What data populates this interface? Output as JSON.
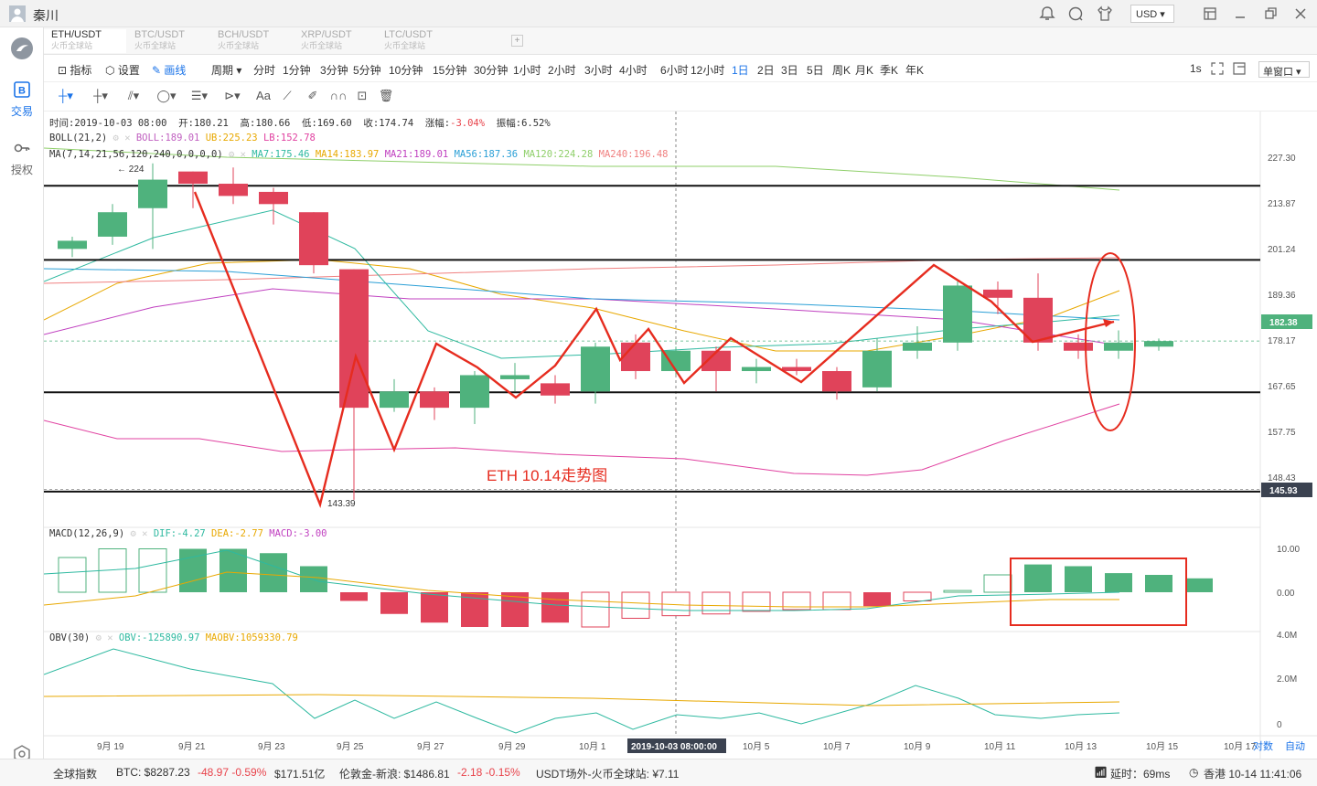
{
  "window": {
    "user_name": "秦川",
    "currency": "USD ▾"
  },
  "sidebar": {
    "trade_label": "交易",
    "auth_label": "授权"
  },
  "tabs": [
    {
      "pair": "ETH/USDT",
      "sub": "火币全球站"
    },
    {
      "pair": "BTC/USDT",
      "sub": "火币全球站"
    },
    {
      "pair": "BCH/USDT",
      "sub": "火币全球站"
    },
    {
      "pair": "XRP/USDT",
      "sub": "火币全球站"
    },
    {
      "pair": "LTC/USDT",
      "sub": "火币全球站"
    }
  ],
  "toolbar": {
    "indicator": "指标",
    "settings": "设置",
    "draw": "画线",
    "period": "周期",
    "periods": [
      "分时",
      "1分钟",
      "3分钟",
      "5分钟",
      "10分钟",
      "15分钟",
      "30分钟",
      "1小时",
      "2小时",
      "3小时",
      "4小时",
      "6小时",
      "12小时",
      "1日",
      "2日",
      "3日",
      "5日",
      "周K",
      "月K",
      "季K",
      "年K"
    ],
    "active_period": "1日",
    "speed": "1s",
    "window_mode": "单窗口 ▾"
  },
  "info_lines": {
    "time": "时间:2019-10-03 08:00",
    "open_label": "开:",
    "open": "180.21",
    "high_label": "高:",
    "high": "180.66",
    "low_label": "低:",
    "low": "169.60",
    "close_label": "收:",
    "close": "174.74",
    "change_label": "涨幅:",
    "change": "-3.04%",
    "amp_label": "振幅:",
    "amp": "6.52%",
    "boll_name": "BOLL(21,2)",
    "boll": "BOLL:189.01",
    "ub": "UB:225.23",
    "lb": "LB:152.78",
    "ma_name": "MA(7,14,21,56,120,240,0,0,0,0)",
    "ma7": "MA7:175.46",
    "ma14": "MA14:183.97",
    "ma21": "MA21:189.01",
    "ma56": "MA56:187.36",
    "ma120": "MA120:224.28",
    "ma240": "MA240:196.48",
    "macd_name": "MACD(12,26,9)",
    "dif": "DIF:-4.27",
    "dea": "DEA:-2.77",
    "macd": "MACD:-3.00",
    "obv_name": "OBV(30)",
    "obv": "OBV:-125890.97",
    "maobv": "MAOBV:1059330.79"
  },
  "chart_data": {
    "type": "candlestick",
    "title": "ETH 10.14走势图",
    "x_labels": [
      "9月 19",
      "9月 21",
      "9月 23",
      "9月 25",
      "9月 27",
      "9月 29",
      "10月 1",
      "2019-10-03 08:00:00",
      "10月 5",
      "10月 7",
      "10月 9",
      "10月 11",
      "10月 13",
      "10月 15",
      "10月 17"
    ],
    "y_ticks": [
      "227.30",
      "213.87",
      "201.24",
      "189.36",
      "178.17",
      "167.65",
      "157.75",
      "148.43"
    ],
    "current_price": "182.38",
    "low_marker": "145.93",
    "high_annotation": "← 224",
    "low_annotation": "143.39",
    "macd_ticks": [
      "10.00",
      "0.00"
    ],
    "obv_ticks": [
      "4.0M",
      "2.0M",
      "0"
    ],
    "log_label": "对数",
    "auto_label": "自动",
    "candles": [
      {
        "o": 205,
        "h": 208,
        "l": 203,
        "c": 207
      },
      {
        "o": 208,
        "h": 216,
        "l": 206,
        "c": 214
      },
      {
        "o": 215,
        "h": 226,
        "l": 205,
        "c": 222
      },
      {
        "o": 224,
        "h": 224,
        "l": 215,
        "c": 221
      },
      {
        "o": 221,
        "h": 225,
        "l": 216,
        "c": 218
      },
      {
        "o": 219,
        "h": 220,
        "l": 211,
        "c": 216
      },
      {
        "o": 214,
        "h": 214,
        "l": 199,
        "c": 201
      },
      {
        "o": 200,
        "h": 200,
        "l": 143.39,
        "c": 166
      },
      {
        "o": 166,
        "h": 173,
        "l": 165,
        "c": 170
      },
      {
        "o": 170,
        "h": 171,
        "l": 163,
        "c": 166
      },
      {
        "o": 166,
        "h": 175,
        "l": 162,
        "c": 174
      },
      {
        "o": 173,
        "h": 177,
        "l": 170,
        "c": 174
      },
      {
        "o": 172,
        "h": 174,
        "l": 167,
        "c": 169
      },
      {
        "o": 170,
        "h": 182,
        "l": 167,
        "c": 181
      },
      {
        "o": 182,
        "h": 184,
        "l": 173,
        "c": 175
      },
      {
        "o": 175,
        "h": 181,
        "l": 174,
        "c": 180
      },
      {
        "o": 180,
        "h": 181,
        "l": 170,
        "c": 175
      },
      {
        "o": 175,
        "h": 178,
        "l": 172,
        "c": 176
      },
      {
        "o": 176,
        "h": 178,
        "l": 174,
        "c": 175
      },
      {
        "o": 175,
        "h": 176,
        "l": 168,
        "c": 170
      },
      {
        "o": 171,
        "h": 183,
        "l": 170,
        "c": 180
      },
      {
        "o": 180,
        "h": 186,
        "l": 178,
        "c": 182
      },
      {
        "o": 182,
        "h": 197,
        "l": 180,
        "c": 196
      },
      {
        "o": 195,
        "h": 197,
        "l": 189,
        "c": 193
      },
      {
        "o": 193,
        "h": 199,
        "l": 180,
        "c": 182
      },
      {
        "o": 182,
        "h": 184,
        "l": 178,
        "c": 180
      },
      {
        "o": 180,
        "h": 185,
        "l": 178,
        "c": 182
      },
      {
        "o": 181,
        "h": 183,
        "l": 180,
        "c": 182.38
      }
    ],
    "macd_bars": [
      4,
      5,
      5,
      5,
      5,
      4.5,
      3,
      -1,
      -2.5,
      -3.5,
      -4,
      -4,
      -3.5,
      -4,
      -3,
      -2.7,
      -2.5,
      -2.2,
      -2,
      -2,
      -1.6,
      -1,
      0.2,
      2,
      3.2,
      3,
      2.2,
      2,
      1.6
    ],
    "obv_values": [
      2.2,
      3.4,
      2.8,
      2.2,
      0.2,
      1.2,
      0.4,
      0.7,
      -0.2,
      0.8,
      0.6,
      1.0,
      1.8,
      1.0,
      0.4,
      0.4
    ],
    "h_lines": [
      220.5,
      202.3,
      169.8,
      145.4
    ],
    "ellipse": {
      "label": "",
      "center_price": 181,
      "center_x_index": 27
    },
    "box": {
      "label": ""
    }
  },
  "status": {
    "index_label": "全球指数",
    "btc": "BTC:  $8287.23",
    "btc_chg": "-48.97 -0.59%",
    "btc_vol": "$171.51亿",
    "gold": "伦敦金-新浪:  $1486.81",
    "gold_chg": "-2.18 -0.15%",
    "usdt": "USDT场外-火币全球站:  ¥7.11",
    "latency": "延时：69ms",
    "clock": "香港 10-14 11:41:06"
  },
  "colors": {
    "up": "#4fb27d",
    "down": "#e0435a",
    "accent": "#1a73e8"
  }
}
